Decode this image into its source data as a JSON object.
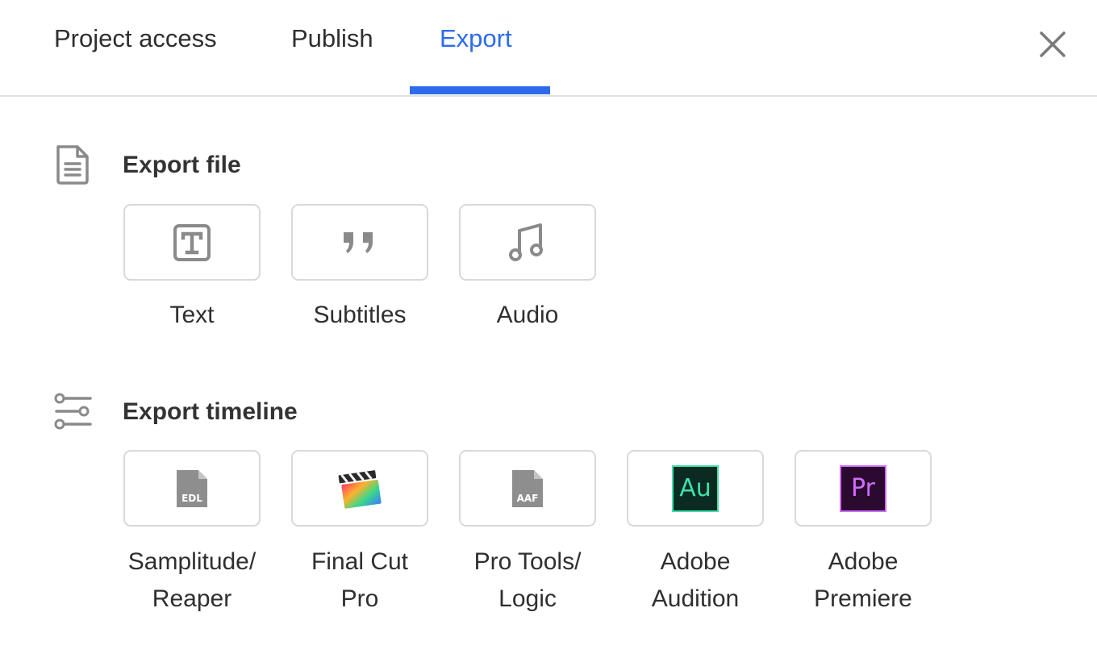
{
  "tabs": [
    {
      "label": "Project access",
      "active": false
    },
    {
      "label": "Publish",
      "active": false
    },
    {
      "label": "Export",
      "active": true
    }
  ],
  "accent_color": "#2d6bea",
  "export_file": {
    "title": "Export file",
    "icon": "document-icon",
    "items": [
      {
        "label": "Text",
        "icon": "text-format-icon"
      },
      {
        "label": "Subtitles",
        "icon": "quote-icon"
      },
      {
        "label": "Audio",
        "icon": "music-note-icon"
      }
    ]
  },
  "export_timeline": {
    "title": "Export timeline",
    "icon": "timeline-sliders-icon",
    "items": [
      {
        "label_line1": "Samplitude/",
        "label_line2": "Reaper",
        "icon": "edl-file-icon",
        "icon_text": "EDL"
      },
      {
        "label_line1": "Final Cut",
        "label_line2": "Pro",
        "icon": "final-cut-pro-icon"
      },
      {
        "label_line1": "Pro Tools/",
        "label_line2": "Logic",
        "icon": "aaf-file-icon",
        "icon_text": "AAF"
      },
      {
        "label_line1": "Adobe",
        "label_line2": "Audition",
        "icon": "adobe-audition-icon",
        "icon_text": "Au"
      },
      {
        "label_line1": "Adobe",
        "label_line2": "Premiere",
        "icon": "adobe-premiere-icon",
        "icon_text": "Pr"
      }
    ]
  }
}
